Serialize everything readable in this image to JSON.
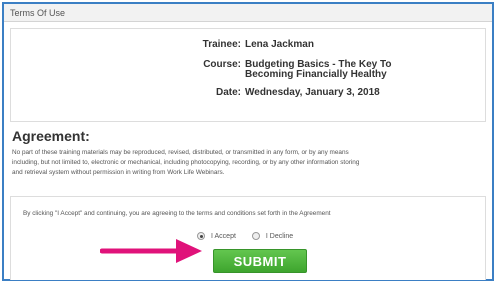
{
  "window": {
    "title": "Terms Of Use"
  },
  "info": {
    "trainee_label": "Trainee:",
    "trainee_value": "Lena Jackman",
    "course_label": "Course:",
    "course_value_line1": "Budgeting Basics - The Key To",
    "course_value_line2": "Becoming Financially Healthy",
    "date_label": "Date:",
    "date_value": "Wednesday, January 3, 2018"
  },
  "agreement": {
    "heading": "Agreement:",
    "line1": "No part of these training materials may be reproduced, revised, distributed, or transmitted in any form, or by any means",
    "line2": "including, but not limited to, electronic or mechanical, including photocopying, recording, or by any other information storing",
    "line3": "and retrieval system without permission in writing from Work Life Webinars."
  },
  "accept": {
    "notice": "By clicking \"I Accept\" and continuing, you are agreeing to the terms and conditions set forth in the Agreement",
    "option_accept": "I Accept",
    "option_decline": "I Decline",
    "selected": "I Accept",
    "submit_label": "SUBMIT"
  },
  "colors": {
    "frame_border": "#3b7fc4",
    "submit_green": "#4cb53a",
    "arrow_pink": "#e0127a"
  },
  "annotation": {
    "icon": "arrow-right-icon"
  }
}
